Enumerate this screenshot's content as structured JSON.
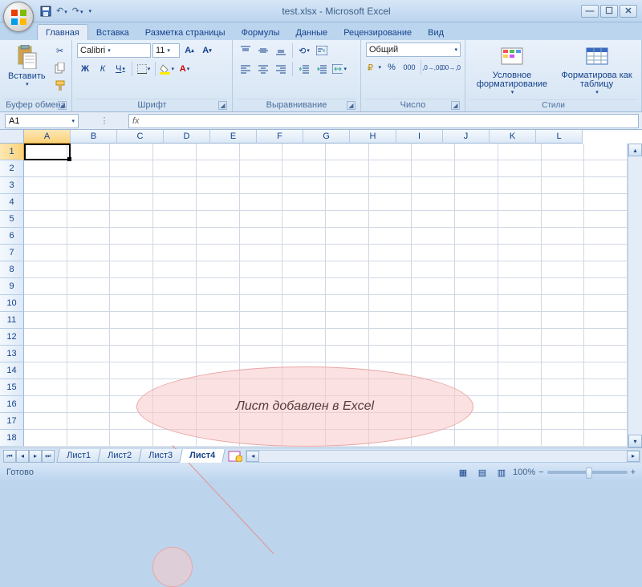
{
  "title": "test.xlsx - Microsoft Excel",
  "tabs": {
    "home": "Главная",
    "insert": "Вставка",
    "page_layout": "Разметка страницы",
    "formulas": "Формулы",
    "data": "Данные",
    "review": "Рецензирование",
    "view": "Вид"
  },
  "groups": {
    "clipboard": {
      "label": "Буфер обмена",
      "paste": "Вставить"
    },
    "font": {
      "label": "Шрифт",
      "family": "Calibri",
      "size": "11",
      "bold": "Ж",
      "italic": "К",
      "underline": "Ч"
    },
    "alignment": {
      "label": "Выравнивание"
    },
    "number": {
      "label": "Число",
      "format": "Общий"
    },
    "styles": {
      "label": "Стили",
      "cond": "Условное форматирование",
      "table": "Форматирова как таблицу"
    }
  },
  "name_box": "A1",
  "columns": [
    "A",
    "B",
    "C",
    "D",
    "E",
    "F",
    "G",
    "H",
    "I",
    "J",
    "K",
    "L"
  ],
  "rows": [
    "1",
    "2",
    "3",
    "4",
    "5",
    "6",
    "7",
    "8",
    "9",
    "10",
    "11",
    "12",
    "13",
    "14",
    "15",
    "16",
    "17",
    "18"
  ],
  "callout": "Лист добавлен в Excel",
  "sheets": [
    "Лист1",
    "Лист2",
    "Лист3",
    "Лист4"
  ],
  "active_sheet": 3,
  "status": "Готово",
  "zoom": "100%"
}
